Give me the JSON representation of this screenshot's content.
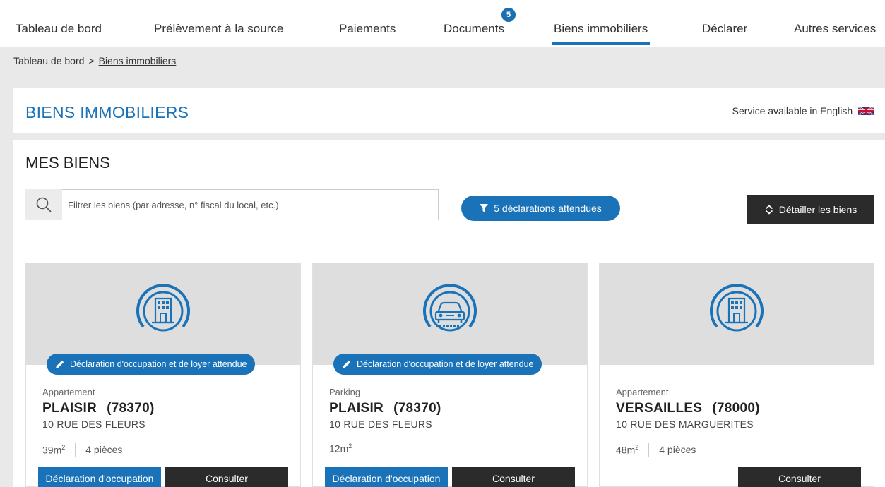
{
  "nav": {
    "items": [
      {
        "label": "Tableau de bord"
      },
      {
        "label": "Prélèvement à la source"
      },
      {
        "label": "Paiements"
      },
      {
        "label": "Documents"
      },
      {
        "label": "Biens immobiliers"
      },
      {
        "label": "Déclarer"
      },
      {
        "label": "Autres services"
      }
    ],
    "documents_badge": "5",
    "active": "Biens immobiliers"
  },
  "breadcrumb": {
    "home": "Tableau de bord",
    "separator": ">",
    "current": "Biens immobiliers"
  },
  "header": {
    "title": "BIENS IMMOBILIERS",
    "english_link": "Service available in English"
  },
  "section": {
    "title": "MES BIENS",
    "search_placeholder": "Filtrer les biens (par adresse, n° fiscal du local, etc.)",
    "filter_button": "5 déclarations attendues",
    "detail_button": "Détailler les biens"
  },
  "cards": [
    {
      "icon": "building-icon",
      "pill": "Déclaration d'occupation et de loyer attendue",
      "type": "Appartement",
      "city": "PLAISIR",
      "postal": "(78370)",
      "street": "10 RUE DES FLEURS",
      "area": "39m",
      "area_sup": "2",
      "rooms": "4 pièces",
      "decl_button": "Déclaration d'occupation",
      "consult_button": "Consulter"
    },
    {
      "icon": "car-icon",
      "pill": "Déclaration d'occupation et de loyer attendue",
      "type": "Parking",
      "city": "PLAISIR",
      "postal": "(78370)",
      "street": "10 RUE DES FLEURS",
      "area": "12m",
      "area_sup": "2",
      "decl_button": "Déclaration d'occupation",
      "consult_button": "Consulter"
    },
    {
      "icon": "building-icon",
      "type": "Appartement",
      "city": "VERSAILLES",
      "postal": "(78000)",
      "street": "10 RUE DES MARGUERITES",
      "area": "48m",
      "area_sup": "2",
      "rooms": "4 pièces",
      "consult_button": "Consulter"
    }
  ],
  "colors": {
    "accent": "#1a73b8",
    "dark_button": "#2b2b2b",
    "card_top": "#dedede"
  }
}
